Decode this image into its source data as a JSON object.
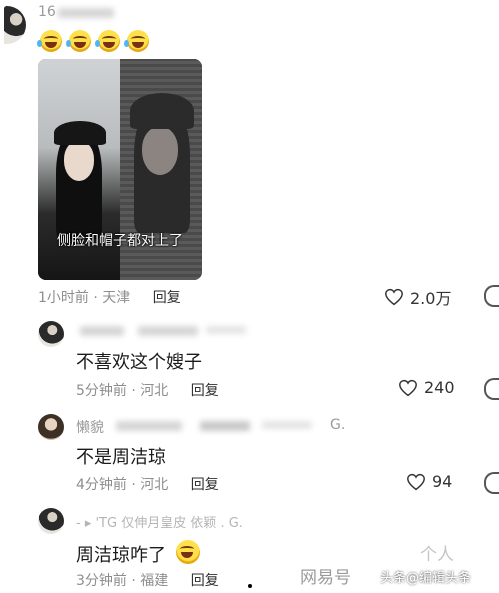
{
  "top_comment": {
    "username": "16",
    "photo_caption": "侧脸和帽子都对上了",
    "time_location": "1小时前 · 天津",
    "reply_label": "回复",
    "likes": "2.0万"
  },
  "replies": [
    {
      "username": "",
      "text": "不喜欢这个嫂子",
      "time_location": "5分钟前 · 河北",
      "reply_label": "回复",
      "likes": "240"
    },
    {
      "username": "懒貌",
      "username_tail": "G.",
      "text": "不是周洁琼",
      "time_location": "4分钟前 · 河北",
      "reply_label": "回复",
      "likes": "94"
    },
    {
      "username": "- ▸ 'TG 仅伸月皇皮 依颖 . G.",
      "text": "周洁琼咋了",
      "time_location": "3分钟前 · 福建",
      "reply_label": "回复",
      "likes": ""
    }
  ],
  "watermark": {
    "brand": "网易号",
    "source": "头条@编辑头条",
    "partial": "个人"
  },
  "icons": [
    "laughing-tears-emoji",
    "heart-icon",
    "smile-emoji",
    "avatar"
  ]
}
